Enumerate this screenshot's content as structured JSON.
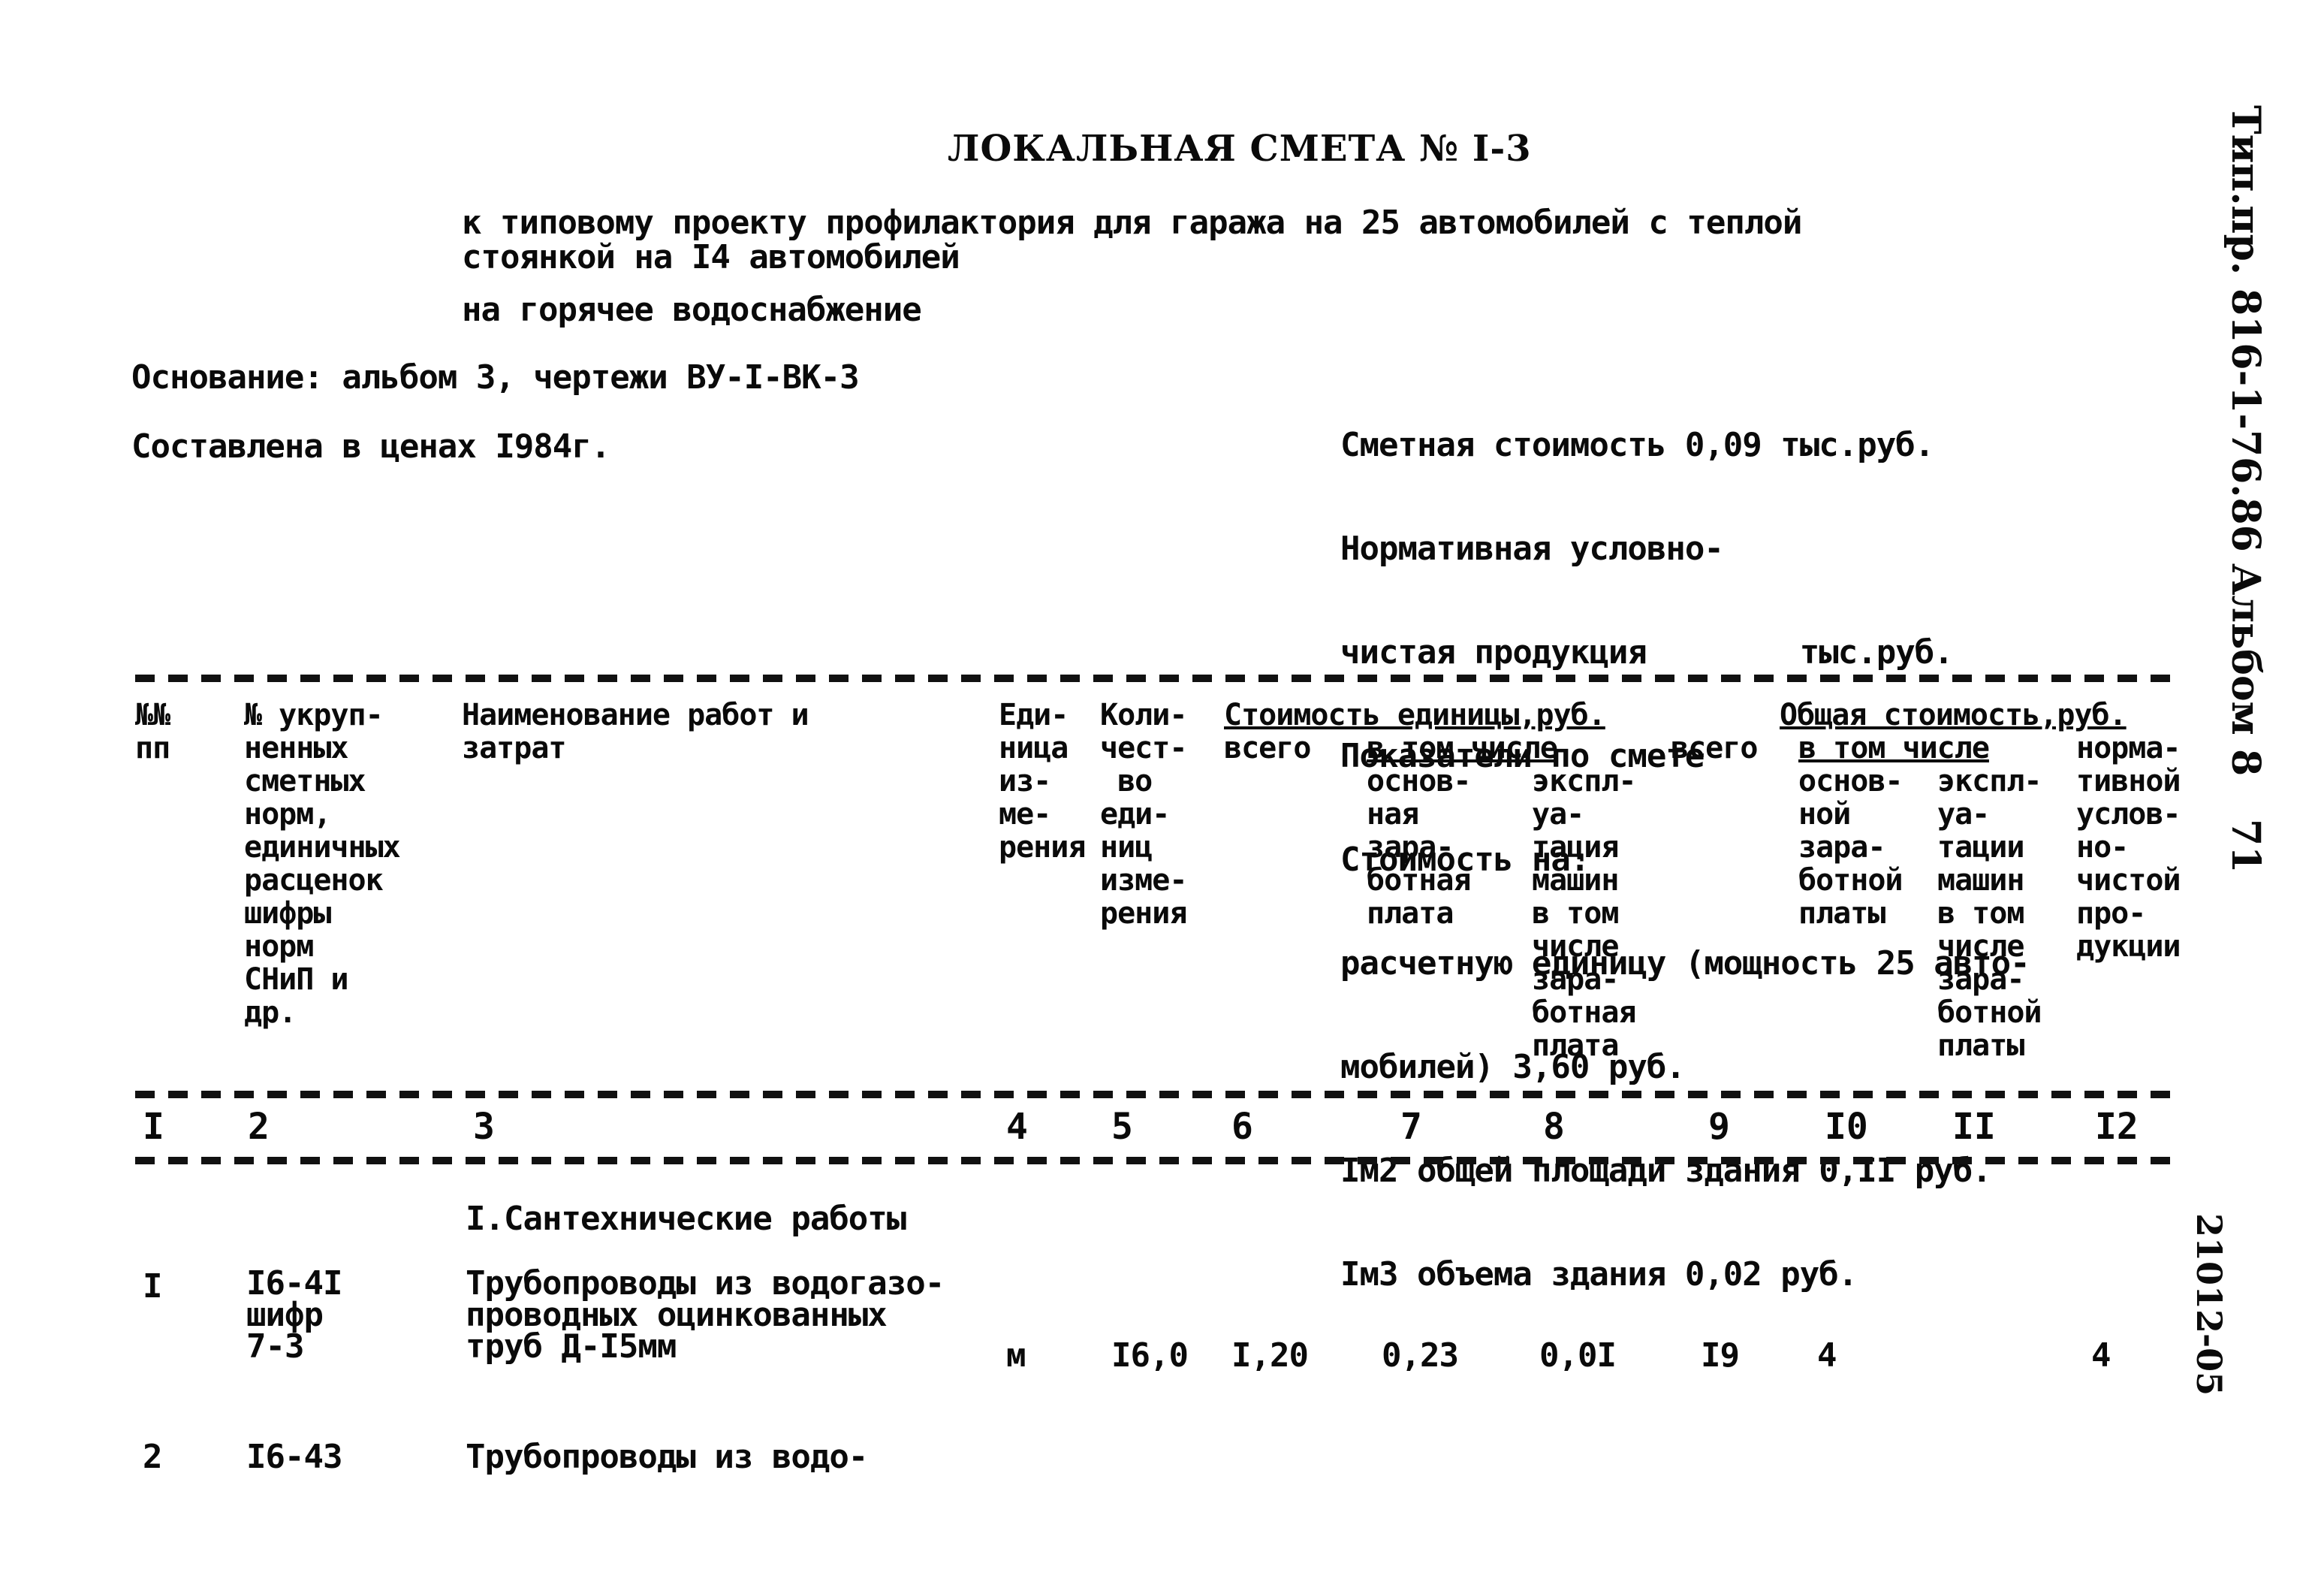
{
  "document": {
    "title": "ЛОКАЛЬНАЯ СМЕТА № I-3",
    "subtitle_line1": "к типовому проекту профилактория для гаража на 25 автомобилей с теплой",
    "subtitle_line2": "стоянкой на I4 автомобилей",
    "subtitle_line3": "на горячее водоснабжение",
    "basis": "Основание: альбом 3, чертежи ВУ-I-ВК-3",
    "prices": "Составлена в ценах I984г.",
    "summary": [
      "Сметная стоимость 0,09 тыс.руб.",
      "Нормативная условно-",
      "чистая продукция        тыс.руб.",
      "Показатели по смете",
      "Стоимость на:",
      "расчетную единицу (мощность 25 авто-",
      "мобилей) 3,60 руб.",
      "Iм2 общей площади здания 0,II руб.",
      "Iм3 объема здания 0,02 руб."
    ],
    "margin": {
      "project_code": "Тип.пр. 816-1-76.86",
      "album": "Альбом 8",
      "page": "71",
      "stamp": "21012-05"
    }
  },
  "table": {
    "headers": {
      "c1": "№№\nпп",
      "c2": "№ укруп-\nненных\nсметных\nнорм,\nединичных\nрасценок\nшифры\nнорм\nСНиП и\nдр.",
      "c3": "Наименование работ и\nзатрат",
      "c4": "Еди-\nница\nиз-\nме-\nрения",
      "c5": "Коли-\nчест-\n во\nеди-\nниц\nизме-\nрения",
      "unit_cost_group": "Стоимость единицы,руб.",
      "total_cost_group": "Общая стоимость,руб.",
      "c6": "всего",
      "in_that_number": "в том числе",
      "c7": "основ-\nная\nзара-\nботная\nплата",
      "c8": "экспл-\nуа-\nтация\nмашин\nв том\nчисле\nзара-\nботная\nплата",
      "c9": "всего",
      "c10": "основ-\nной\nзара-\nботной\nплаты",
      "c11": "экспл-\nуа-\nтации\nмашин\nв том\nчисле\nзара-\nботной\nплаты",
      "c12": "норма-\nтивной\nуслов-\nно-\nчистой\nпро-\nдукции"
    },
    "column_numbers": [
      "I",
      "2",
      "3",
      "4",
      "5",
      "6",
      "7",
      "8",
      "9",
      "I0",
      "II",
      "I2"
    ],
    "section_title": "I.Сантехнические работы",
    "rows": [
      {
        "num": "I",
        "code": "I6-4I\nшифр\n7-3",
        "name": "Трубопроводы из водогазо-\nпроводных оцинкованных\nтруб Д-I5мм",
        "unit": "м",
        "qty": "I6,0",
        "unit_total": "I,20",
        "unit_wage": "0,23",
        "unit_machine": "0,0I",
        "total": "I9",
        "total_wage": "4",
        "total_machine": "",
        "normative": "4"
      },
      {
        "num": "2",
        "code": "I6-43",
        "name": "Трубопроводы из водо-",
        "unit": "",
        "qty": "",
        "unit_total": "",
        "unit_wage": "",
        "unit_machine": "",
        "total": "",
        "total_wage": "",
        "total_machine": "",
        "normative": ""
      }
    ]
  }
}
